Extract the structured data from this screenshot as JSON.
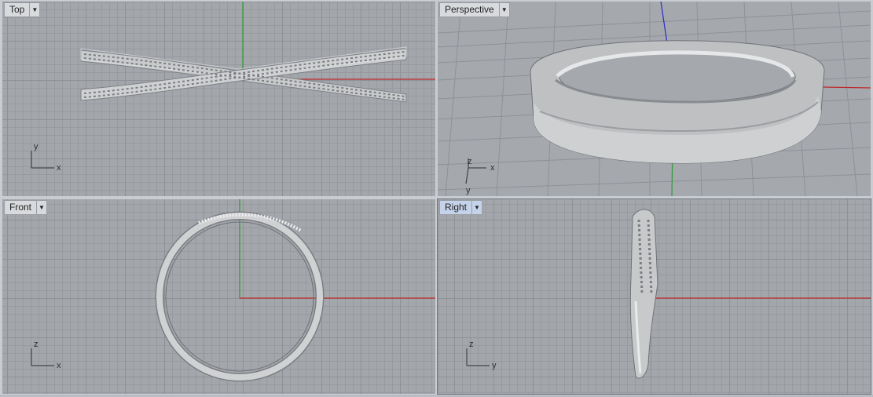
{
  "viewports": {
    "top": {
      "title": "Top",
      "axis_h": "x",
      "axis_v": "y"
    },
    "persp": {
      "title": "Perspective",
      "axis_h": "x",
      "axis_v": "z",
      "axis_d": "y"
    },
    "front": {
      "title": "Front",
      "axis_h": "x",
      "axis_v": "z"
    },
    "right": {
      "title": "Right",
      "axis_h": "y",
      "axis_v": "z"
    }
  },
  "active_viewport": "Right",
  "icons": {
    "tab_menu": "chevron-down-icon"
  },
  "colors": {
    "x_axis": "#c0282a",
    "y_axis": "#2e9a35",
    "z_axis": "#2a2ac8",
    "model": "#d4d5d7",
    "model_shadow": "#8c8f93",
    "grid_major": "#8e9297",
    "grid_minor": "#979ba0",
    "viewport_bg": "#a3a7ac"
  }
}
